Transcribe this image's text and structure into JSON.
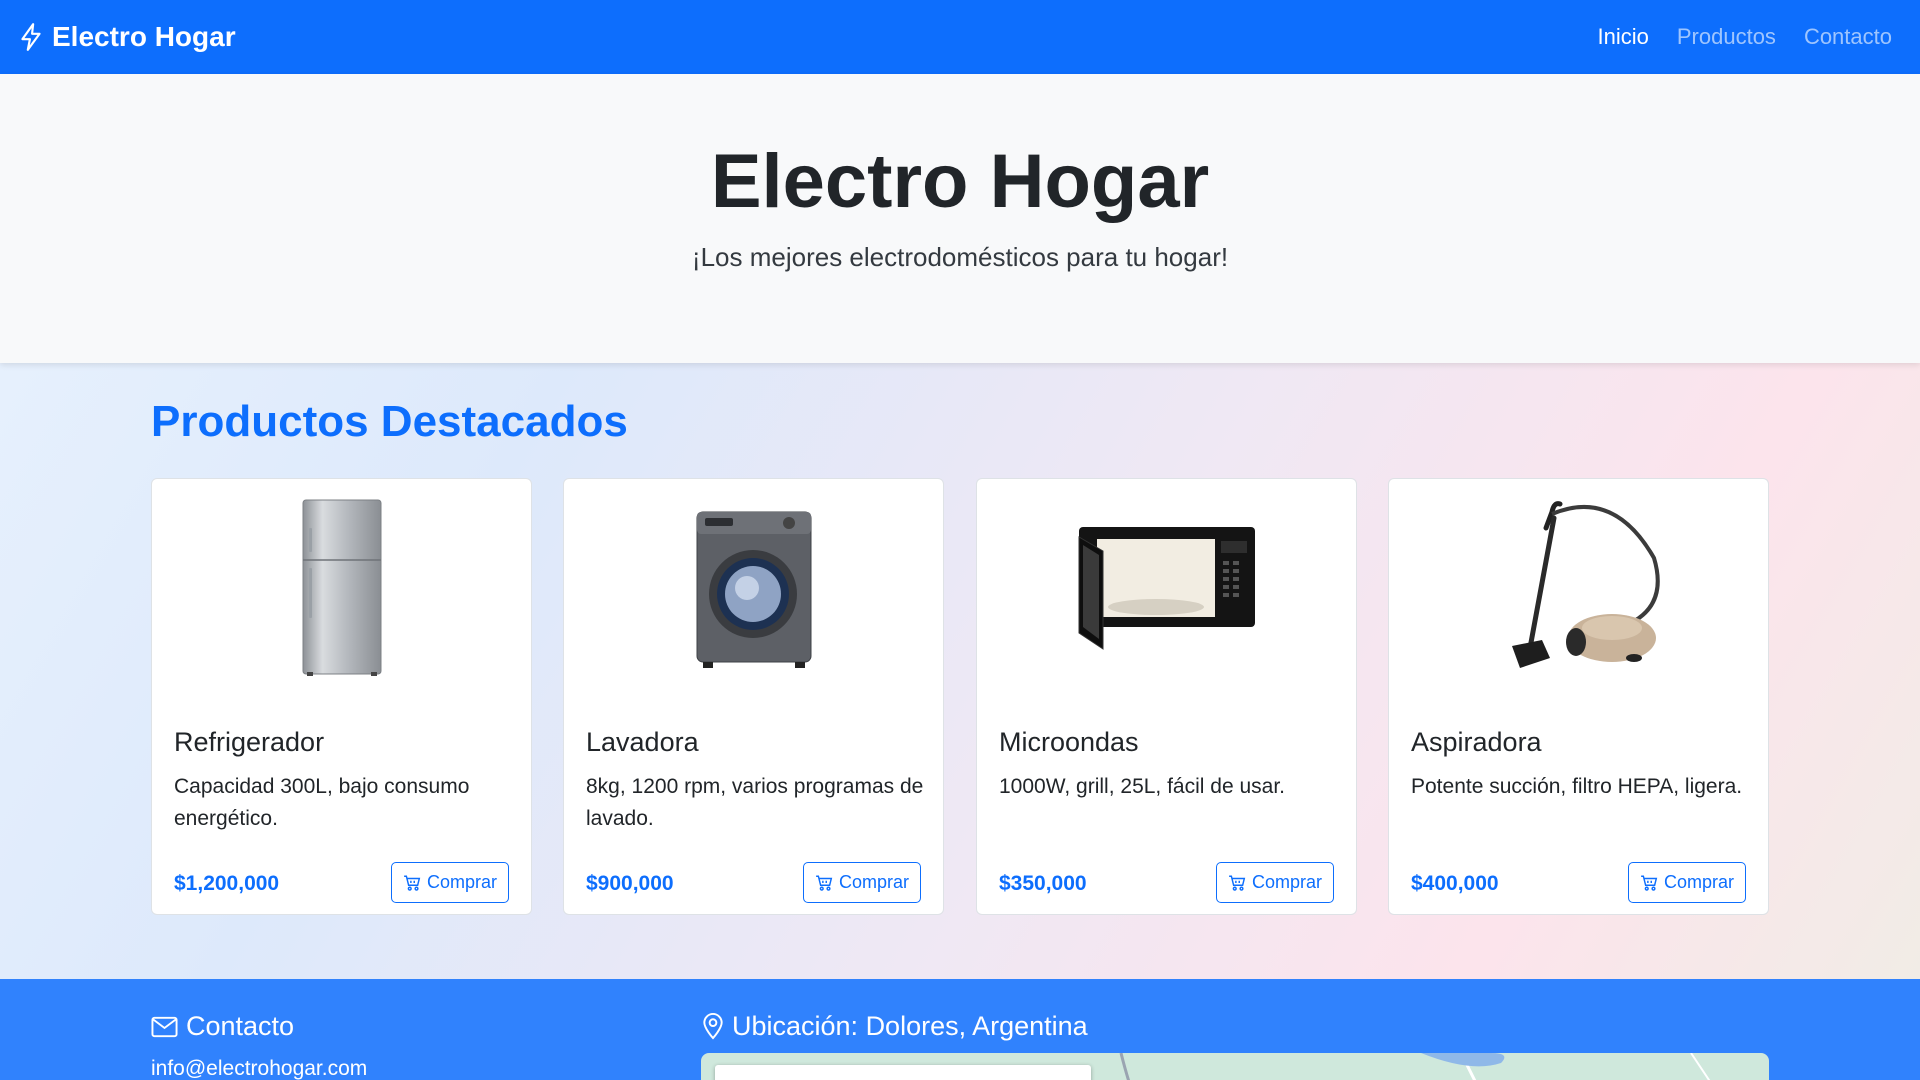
{
  "navbar": {
    "brand": "Electro Hogar",
    "links": [
      {
        "label": "Inicio",
        "active": true
      },
      {
        "label": "Productos",
        "active": false
      },
      {
        "label": "Contacto",
        "active": false
      }
    ]
  },
  "hero": {
    "title": "Electro Hogar",
    "subtitle": "¡Los mejores electrodomésticos para tu hogar!"
  },
  "products": {
    "heading": "Productos Destacados",
    "items": [
      {
        "name": "Refrigerador",
        "description": "Capacidad 300L, bajo consumo energético.",
        "price": "$1,200,000",
        "button": "Comprar",
        "image": "refrigerator-image"
      },
      {
        "name": "Lavadora",
        "description": "8kg, 1200 rpm, varios programas de lavado.",
        "price": "$900,000",
        "button": "Comprar",
        "image": "washing-machine-image"
      },
      {
        "name": "Microondas",
        "description": "1000W, grill, 25L, fácil de usar.",
        "price": "$350,000",
        "button": "Comprar",
        "image": "microwave-image"
      },
      {
        "name": "Aspiradora",
        "description": "Potente succión, filtro HEPA, ligera.",
        "price": "$400,000",
        "button": "Comprar",
        "image": "vacuum-cleaner-image"
      }
    ]
  },
  "footer": {
    "contact_heading": "Contacto",
    "email": "info@electrohogar.com",
    "location_heading": "Ubicación: Dolores, Argentina"
  },
  "colors": {
    "primary": "#0d6efd",
    "footer": "#3082fd",
    "hero_bg": "#f8f9fa"
  }
}
